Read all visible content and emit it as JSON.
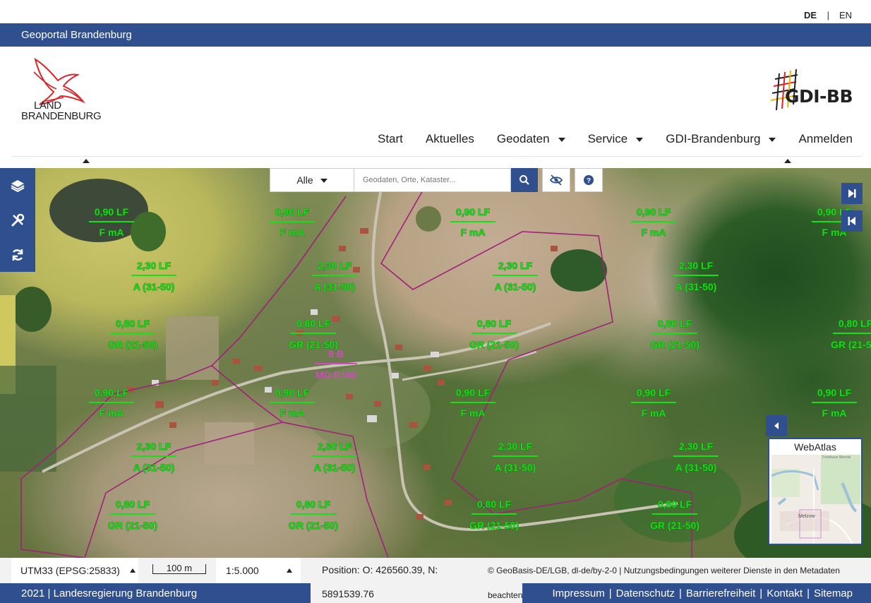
{
  "lang": {
    "de": "DE",
    "separator": "|",
    "en": "EN"
  },
  "title": "Geoportal Brandenburg",
  "logo_left": {
    "line1": "LAND",
    "line2": "BRANDENBURG"
  },
  "logo_right": {
    "text": "GDI-BB"
  },
  "nav": {
    "items": [
      {
        "label": "Start",
        "dropdown": false
      },
      {
        "label": "Aktuelles",
        "dropdown": false
      },
      {
        "label": "Geodaten",
        "dropdown": true
      },
      {
        "label": "Service",
        "dropdown": true
      },
      {
        "label": "GDI-Brandenburg",
        "dropdown": true
      },
      {
        "label": "Anmelden",
        "dropdown": false
      }
    ]
  },
  "search": {
    "scope": "Alle",
    "placeholder": "Geodaten, Orte, Kataster..."
  },
  "map_labels": {
    "lf090": "0,90 LF",
    "fma": "F mA",
    "lf230": "2,30 LF",
    "a3150": "A (31-50)",
    "lf080": "0,80 LF",
    "gr2150": "GR (21-50)",
    "plot": "9 B",
    "plot_class": "MD II t40"
  },
  "overview": {
    "title": "WebAtlas",
    "place": "Melzow",
    "place2": "Forsthaus Wernitz"
  },
  "status": {
    "crs": "UTM33 (EPSG:25833)",
    "scale_bar": "100 m",
    "scale": "1:5.000",
    "position_line1": "Position: O: 426560.39, N:",
    "position_line2": "5891539.76",
    "copyright_line1": "© GeoBasis-DE/LGB, dl-de/by-2-0 | Nutzungsbedingungen weiterer Dienste in den Metadaten",
    "copyright_line2": "beachten"
  },
  "footer": {
    "left": "2021 | Landesregierung Brandenburg",
    "links": [
      "Impressum",
      "|",
      "Datenschutz",
      "|",
      "Barrierefreiheit",
      "|",
      "Kontakt",
      "|",
      "Sitemap"
    ]
  },
  "colors": {
    "brand_blue": "#2f4f8f",
    "label_green": "#17e017",
    "label_pink": "#d845c8",
    "boundary": "#a0207a"
  }
}
